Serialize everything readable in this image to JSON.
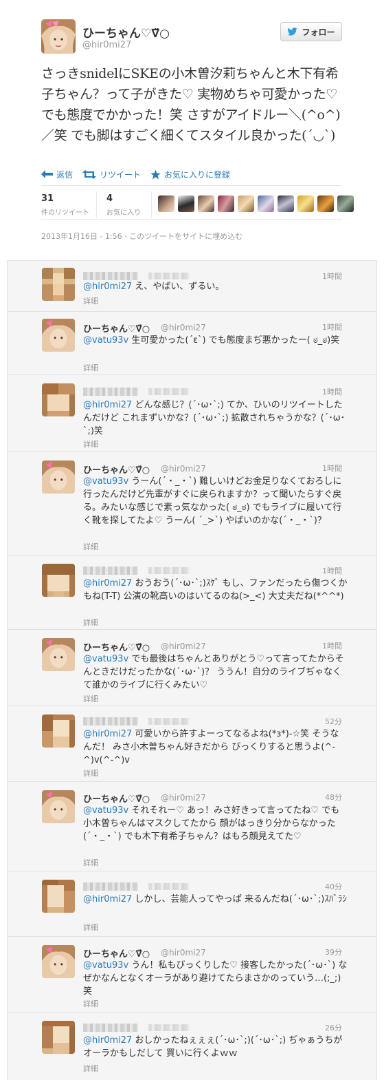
{
  "main_tweet": {
    "display_name": "ひーちゃん♡∇̈○",
    "handle": "@hir0mi27",
    "follow_label": "フォロー",
    "text": "さっきsnidelにSKEの小木曽汐莉ちゃんと木下有希子ちゃん？って子がきた♡ 実物めちゃ可愛かった♡ でも態度でかかった！笑 さすがアイドルー＼(^o^)／笑 でも脚はすごく細くてスタイル良かった(´◡`)",
    "actions": {
      "reply": "返信",
      "retweet": "リツイート",
      "favorite": "お気に入りに登録"
    },
    "stats": {
      "retweets": "31",
      "retweets_label": "件のリツイート",
      "favorites": "4",
      "favorites_label": "お気に入り"
    },
    "timestamp": "2013年1月16日 - 1:56",
    "embed_label": "このツイートをサイトに埋め込む"
  },
  "replies": [
    {
      "name": "",
      "handle": "",
      "time": "1時間",
      "mention": "@hir0mi27",
      "text": " え、やばい、ずるい。",
      "detail": "詳細"
    },
    {
      "name": "ひーちゃん♡∇̈○",
      "handle": "@hir0mi27",
      "time": "1時間",
      "mention": "@vatu93v",
      "text": " 生可愛かった(´ε`) でも態度まぢ悪かったー( ಠ_ಠ)笑",
      "detail": "詳細"
    },
    {
      "name": "",
      "handle": "",
      "time": "1時間",
      "mention": "@hir0mi27",
      "text": " どんな感じ？(´･ω･`;) てか、ひいのリツイートしたんだけど これまずいかな？(´･ω･`;) 拡散されちゃうかな？(´･ω･`;)笑",
      "detail": "詳細"
    },
    {
      "name": "ひーちゃん♡∇̈○",
      "handle": "@hir0mi27",
      "time": "1時間",
      "mention": "@vatu93v",
      "text": " うーん(´・_・`) 難しいけどお金足りなくておろしに行ったんだけど先輩がすぐに戻られますか？って聞いたらすぐ戻る。みたいな感じで素っ気なかった( ಠ_ಠ) でもライブに履いて行く靴を探してたよ♡ うーん( ´_>`) やばいのかな(´・_・`)？",
      "detail": "詳細"
    },
    {
      "name": "",
      "handle": "",
      "time": "1時間",
      "mention": "@hir0mi27",
      "text": " おうおう(´･ω･`;)ｽｹﾞ もし、ファンだったら傷つくかもね(T-T) 公演の靴高いのはいてるのね(>_<) 大丈夫だね(*^^*)",
      "detail": "詳細"
    },
    {
      "name": "ひーちゃん♡∇̈○",
      "handle": "@hir0mi27",
      "time": "1時間",
      "mention": "@vatu93v",
      "text": " でも最後はちゃんとありがとう♡って言ってたからそんときだけだったかな(´･ω･`)？ ううん！自分のライブぢゃなくて誰かのライブに行くみたい♡",
      "detail": "詳細"
    },
    {
      "name": "",
      "handle": "",
      "time": "52分",
      "mention": "@hir0mi27",
      "text": " 可愛いから許すよーってなるよね(*з*)-☆笑 そうなんだ！ みさ小木曽ちゃん好きだから びっくりすると思うよ(^-^)v(^-^)v",
      "detail": "詳細"
    },
    {
      "name": "ひーちゃん♡∇̈○",
      "handle": "@hir0mi27",
      "time": "48分",
      "mention": "@vatu93v",
      "text": " それそれー♡ あっ！みさ好きって言ってたね♡ でも小木曽ちゃんはマスクしてたから 顔がはっきり分からなかった(´・_・`) でも木下有希子ちゃん？はもろ顔見えてた♡",
      "detail": "詳細"
    },
    {
      "name": "",
      "handle": "",
      "time": "40分",
      "mention": "@hir0mi27",
      "text": " しかし、芸能人ってやっぱ 来るんだね(´･ω･`;)ｽﾊﾞﾗｼ",
      "detail": "詳細"
    },
    {
      "name": "ひーちゃん♡∇̈○",
      "handle": "@hir0mi27",
      "time": "39分",
      "mention": "@vatu93v",
      "text": " うん！私もびっくりした♡ 接客したかった(´･ω･`) なぜかなんとなくオーラがあり避けてたらまさかのっていう…(;_;)笑",
      "detail": "詳細"
    },
    {
      "name": "",
      "handle": "",
      "time": "26分",
      "mention": "@hir0mi27",
      "text": " おしかったねぇぇぇ(´･ω･`;)(´･ω･`;) ぢゃぁうちがオーラかもしだして 買いに行くよｗｗ",
      "detail": "詳細"
    }
  ]
}
